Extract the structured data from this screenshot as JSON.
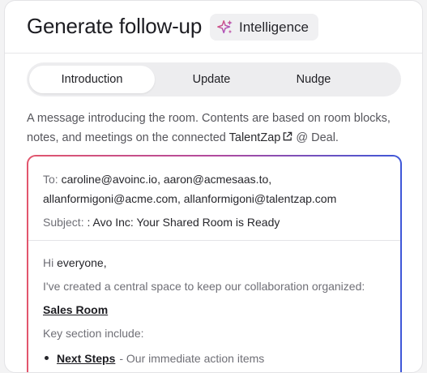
{
  "header": {
    "title": "Generate follow-up",
    "badge_label": "Intelligence",
    "badge_icon": "sparkle-icon"
  },
  "tabs": [
    {
      "label": "Introduction",
      "active": true
    },
    {
      "label": "Update",
      "active": false
    },
    {
      "label": "Nudge",
      "active": false
    }
  ],
  "description": {
    "text_before": "A message introducing the room. Contents are based on room blocks, notes, and meetings on the connected ",
    "link": "TalentZap",
    "text_after": " @ Deal."
  },
  "email": {
    "to_label": "To:",
    "to_line1": "caroline@avoinc.io, aaron@acmesaas.to,",
    "to_line2": "allanformigoni@acme.com, allanformigoni@talentzap.com",
    "subject_label": "Subject:",
    "subject_value": ": Avo Inc: Your Shared Room is Ready",
    "greeting_word": "Hi",
    "greeting_name": "everyone,",
    "intro": "I've created a central space to keep our collaboration organized:",
    "room_link": "Sales Room",
    "sections_heading": "Key section include:",
    "bullets": [
      {
        "title": "Next Steps",
        "desc": "- Our immediate action items"
      }
    ]
  },
  "colors": {
    "gradient_start": "#e2566d",
    "gradient_end": "#3e57d8"
  }
}
